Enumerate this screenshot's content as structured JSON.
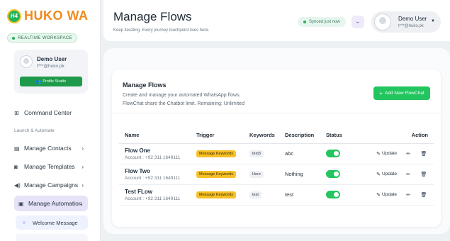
{
  "brand": {
    "badge": "H4",
    "name": "HUKO WA",
    "workspace": "REALTIME WORKSPACE"
  },
  "user_card": {
    "name": "Demo User",
    "email": "t***@huko.pk",
    "button": "Profile Studio"
  },
  "nav": {
    "command_center": "Command Center",
    "section_label": "Launch & Automate",
    "contacts": "Manage Contacts",
    "templates": "Manage Templates",
    "campaigns": "Manage Campaigns",
    "automation": "Manage Automation",
    "welcome": "Welcome Message"
  },
  "header": {
    "title": "Manage Flows",
    "subtitle": "Keep iterating. Every journey touchpoint lives here.",
    "sync": "Synced just now",
    "user_name": "Demo User",
    "user_email": "t***@huko.pk"
  },
  "card": {
    "title": "Manage Flows",
    "desc_line1": "Create and manage your automated WhatsApp flows.",
    "desc_line2": "FlowChat share the Chatbot limit. Remaining: Unlimited",
    "add_button": "Add New FlowChat"
  },
  "table": {
    "headers": {
      "name": "Name",
      "trigger": "Trigger",
      "keywords": "Keywords",
      "description": "Description",
      "status": "Status",
      "action": "Action"
    },
    "update_label": "Update",
    "rows": [
      {
        "name": "Flow One",
        "account": "Account : +92 311 1649111",
        "trigger": "Message Keywords",
        "keyword": "test3",
        "description": "abc",
        "status_on": true
      },
      {
        "name": "Flow Two",
        "account": "Account : +92 311 1649111",
        "trigger": "Message Keywords",
        "keyword": "Here",
        "description": "Nothing",
        "status_on": true
      },
      {
        "name": "Test FLow",
        "account": "Account : +92 311 1649111",
        "trigger": "Message Keywords",
        "keyword": "test",
        "description": "test",
        "status_on": true
      }
    ]
  },
  "colors": {
    "accent_green": "#22c55e",
    "brand_orange": "#f08a1c",
    "trigger_yellow": "#f6c026"
  }
}
